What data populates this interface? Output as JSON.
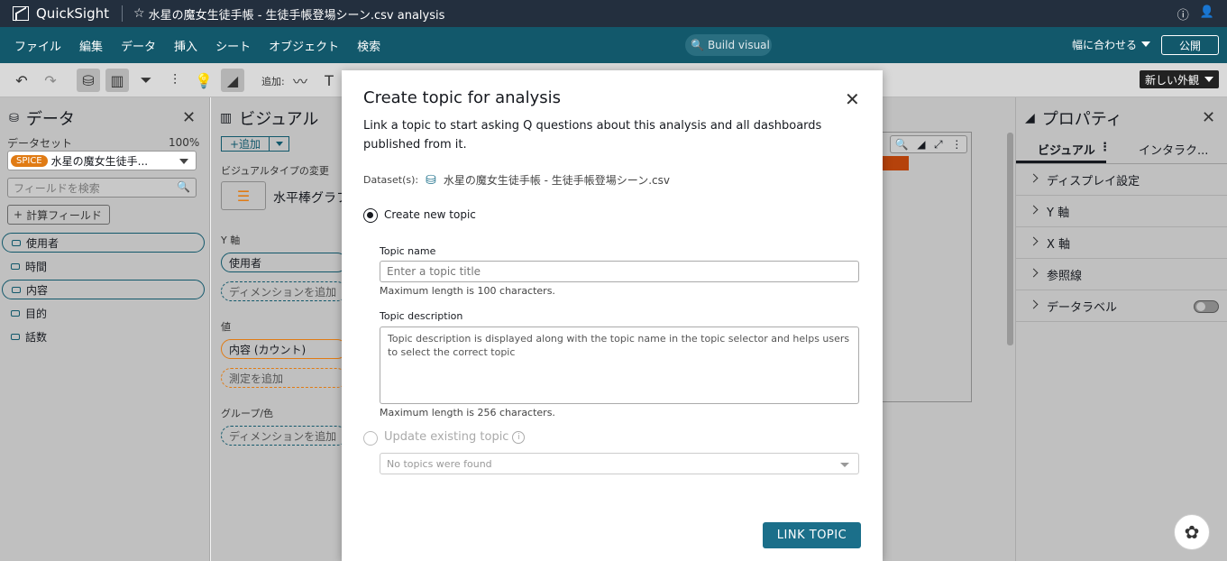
{
  "app": {
    "name": "QuickSight",
    "analysis_title": "水星の魔女生徒手帳 - 生徒手帳登場シーン.csv analysis"
  },
  "menu": [
    "ファイル",
    "編集",
    "データ",
    "挿入",
    "シート",
    "オブジェクト",
    "検索"
  ],
  "menubar": {
    "build_visual": "Build visual",
    "fit": "幅に合わせる",
    "publish": "公開"
  },
  "toolbar": {
    "add_label": "追加:",
    "new_look": "新しい外観"
  },
  "data_panel": {
    "title": "データ",
    "dataset_label": "データセット",
    "dataset_pct": "100%",
    "spice": "SPICE",
    "dataset_name": "水星の魔女生徒手...",
    "search_placeholder": "フィールドを検索",
    "calc_field": "計算フィールド",
    "fields": [
      "使用者",
      "時間",
      "内容",
      "目的",
      "話数"
    ]
  },
  "visual_panel": {
    "title": "ビジュアル",
    "add": "追加",
    "type_change": "ビジュアルタイプの変更",
    "type_name": "水平棒グラフ",
    "y_axis": "Y 軸",
    "y_field": "使用者",
    "add_dimension": "ディメンションを追加",
    "value": "値",
    "value_field": "内容 (カウント)",
    "add_measure": "測定を追加",
    "group": "グループ/色",
    "add_dimension2": "ディメンションを追加"
  },
  "props_panel": {
    "title": "プロパティ",
    "tab_visual": "ビジュアル",
    "tab_interactions": "インタラク...",
    "rows": [
      "ディスプレイ設定",
      "Y 軸",
      "X 軸",
      "参照線",
      "データラベル"
    ]
  },
  "modal": {
    "title": "Create topic for analysis",
    "description": "Link a topic to start asking Q questions about this analysis and all dashboards published from it.",
    "dataset_label": "Dataset(s):",
    "dataset_name": "水星の魔女生徒手帳 - 生徒手帳登場シーン.csv",
    "create_new": "Create new topic",
    "topic_name_label": "Topic name",
    "topic_name_placeholder": "Enter a topic title",
    "topic_name_hint": "Maximum length is 100 characters.",
    "topic_desc_label": "Topic description",
    "topic_desc_placeholder": "Topic description is displayed along with the topic name in the topic selector and helps users to select the correct topic",
    "topic_desc_hint": "Maximum length is 256 characters.",
    "update_existing": "Update existing topic",
    "no_topics": "No topics were found",
    "link_button": "LINK TOPIC"
  },
  "colors": {
    "topbar": "#232f3e",
    "menubar": "#12586b",
    "primary_button": "#1b6f8a",
    "spice": "#e07b14",
    "bar": "#b5420b"
  }
}
